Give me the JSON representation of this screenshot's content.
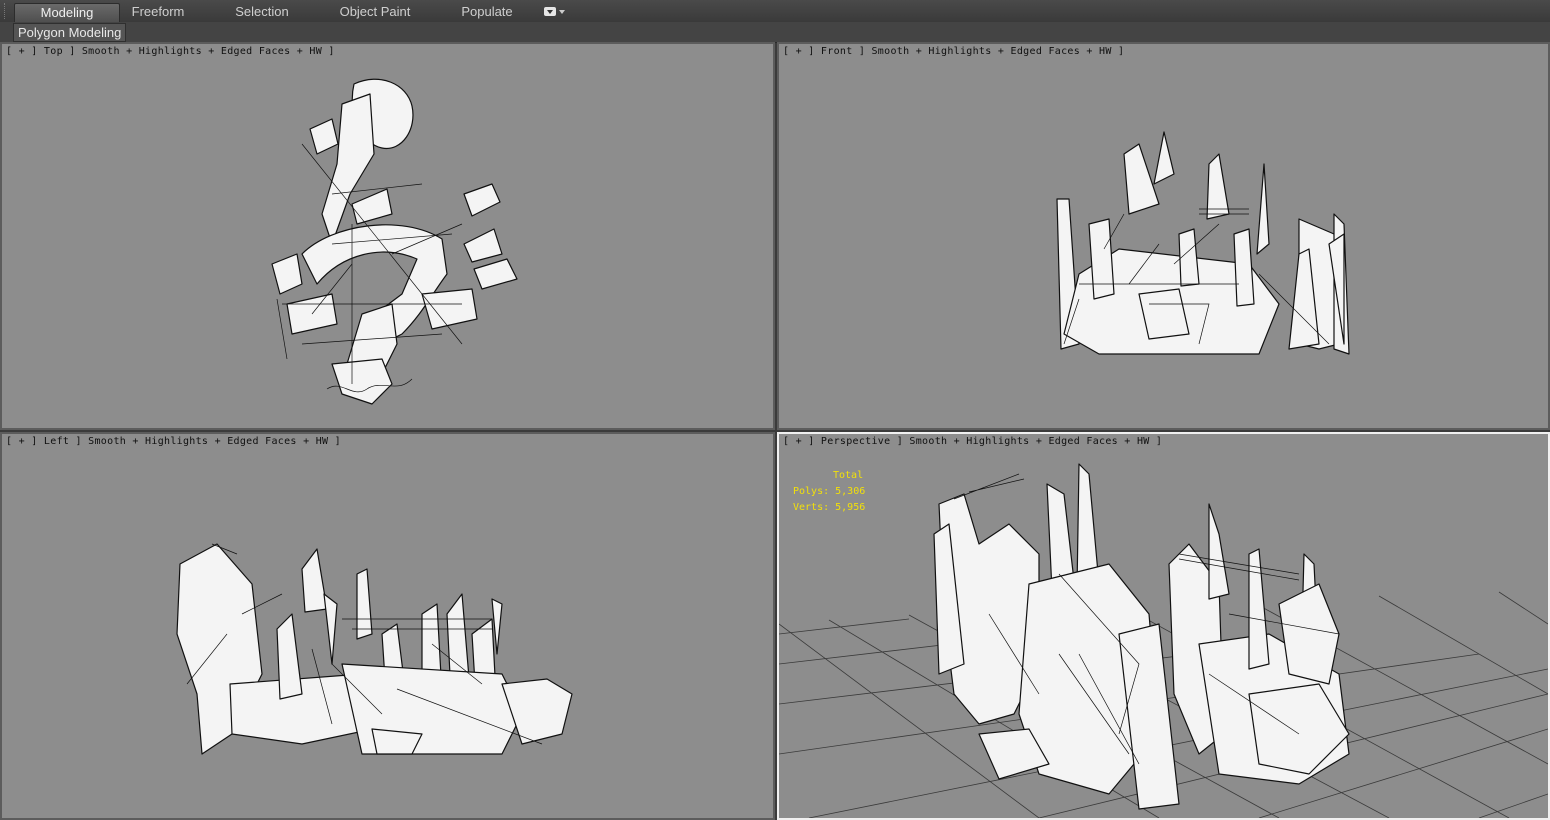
{
  "ribbon": {
    "tabs": [
      {
        "label": "Modeling",
        "active": true
      },
      {
        "label": "Freeform",
        "active": false
      },
      {
        "label": "Selection",
        "active": false
      },
      {
        "label": "Object Paint",
        "active": false
      },
      {
        "label": "Populate",
        "active": false
      }
    ],
    "dropdown_icon": "panel-options-dropdown-icon",
    "sub_panel_label": "Polygon Modeling"
  },
  "viewports": {
    "top": {
      "label": "[ + ] Top ] Smooth + Highlights + Edged Faces + HW ]"
    },
    "front": {
      "label": "[ + ] Front ] Smooth + Highlights + Edged Faces + HW ]"
    },
    "left": {
      "label": "[ + ] Left ] Smooth + Highlights + Edged Faces + HW ]"
    },
    "perspective": {
      "label": "[ + ] Perspective ] Smooth + Highlights + Edged Faces + HW ]",
      "active": true,
      "stats": {
        "total": "Total",
        "polys": "Polys: 5,306",
        "verts": "Verts: 5,956"
      }
    }
  },
  "colors": {
    "viewport_bg": "#8d8d8d",
    "mesh_fill": "#f4f4f4",
    "mesh_wire": "#111111",
    "stats_text": "#f2e00a",
    "active_border": "#f0f0f0"
  }
}
